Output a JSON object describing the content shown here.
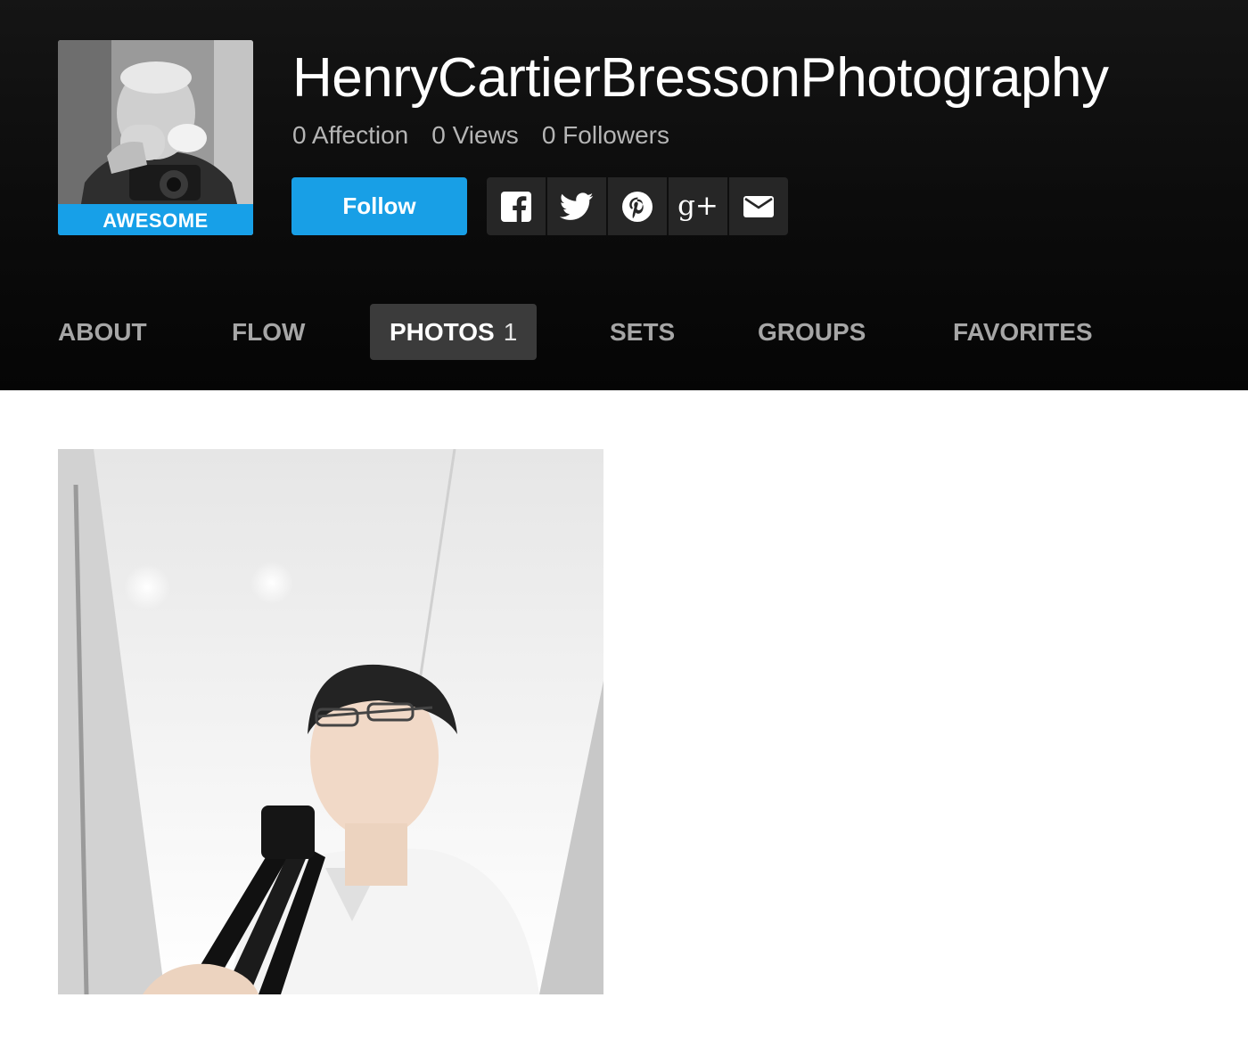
{
  "profile": {
    "name": "HenryCartierBressonPhotography",
    "badge": "AWESOME",
    "stats": [
      {
        "value": "0",
        "label": "Affection"
      },
      {
        "value": "0",
        "label": "Views"
      },
      {
        "value": "0",
        "label": "Followers"
      }
    ],
    "follow_label": "Follow"
  },
  "share": {
    "icons": [
      "facebook-icon",
      "twitter-icon",
      "pinterest-icon",
      "google-plus-icon",
      "email-icon"
    ],
    "google_plus_glyph": "g+"
  },
  "nav": {
    "about": "ABOUT",
    "flow": "FLOW",
    "photos": "PHOTOS",
    "photos_count": "1",
    "sets": "SETS",
    "groups": "GROUPS",
    "favorites": "FAVORITES",
    "active": "photos"
  },
  "colors": {
    "header_bg": "#0d0d0d",
    "accent": "#189fe6",
    "nav_active_bg": "#3b3b3b",
    "nav_text": "#a6a6a6",
    "share_bg": "#262626"
  }
}
